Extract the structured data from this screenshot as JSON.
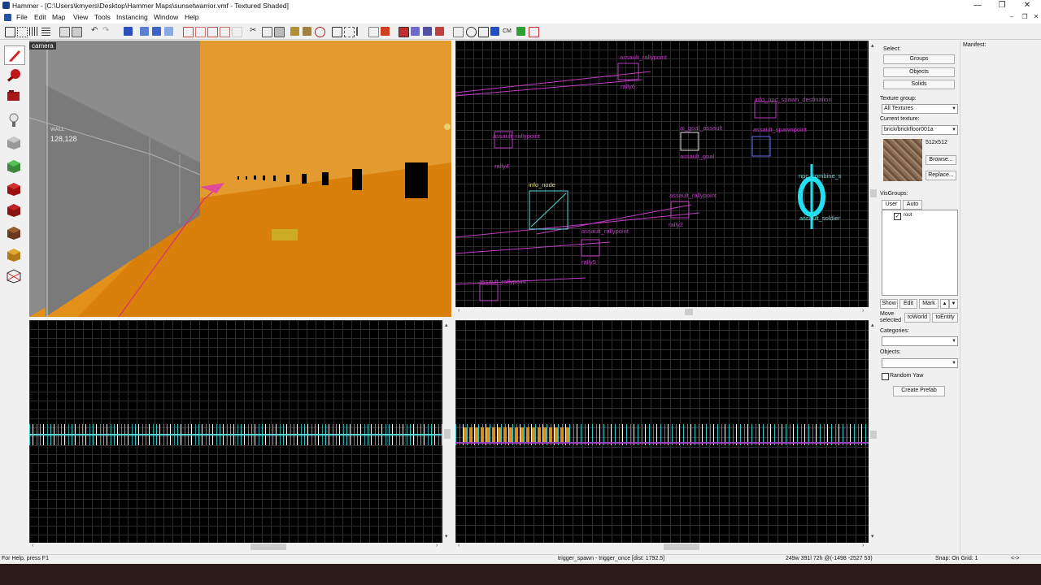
{
  "window": {
    "title": "Hammer - [C:\\Users\\kmyers\\Desktop\\Hammer Maps\\sunsetwarrior.vmf - Textured Shaded]",
    "controls": [
      "—",
      "❐",
      "✕"
    ],
    "doc_controls": [
      "–",
      "❐",
      "✕"
    ]
  },
  "menu": [
    "File",
    "Edit",
    "Map",
    "View",
    "Tools",
    "Instancing",
    "Window",
    "Help"
  ],
  "toolbar": {
    "cm_label": "CM"
  },
  "viewports": {
    "camera": {
      "label": "camera",
      "wall_label": "WALL",
      "wall_coord": "128,128"
    },
    "top": {
      "entities": {
        "assault_rallypoint_1": "assault_rallypoint",
        "rally6": "rally6",
        "info_npc_spawn_destination": "info_npc_spawn_destination",
        "ai_goal_assault": "ai_goal_assault",
        "assault_spawnpoint": "assault_spawnpoint",
        "assault_rallypoint_2": "assault_rallypoint",
        "rally4": "rally4",
        "assault_goal": "assault_goal",
        "npc_combine_s": "npc_combine_s",
        "info_node": "info_node",
        "assault_rallypoint_3": "assault_rallypoint",
        "rally2": "rally2",
        "assault_soldier": "assault_soldier",
        "assault_rallypoint_4": "assault_rallypoint",
        "rally5": "rally5",
        "assault_rallypoint_5": "assault_rallypoint"
      }
    }
  },
  "panel": {
    "select_label": "Select:",
    "groups": "Groups",
    "objects": "Objects",
    "solids": "Solids",
    "texture_group_label": "Texture group:",
    "texture_group_value": "All Textures",
    "current_texture_label": "Current texture:",
    "current_texture_value": "brick/brickfloor001a",
    "texture_size": "512x512",
    "browse": "Browse...",
    "replace": "Replace...",
    "visgroups_label": "VisGroups:",
    "tab_user": "User",
    "tab_auto": "Auto",
    "root_item": "root",
    "show": "Show",
    "edit": "Edit",
    "mark": "Mark",
    "move_selected": "Move selected",
    "to_world": "toWorld",
    "to_entity": "toEntity",
    "categories_label": "Categories:",
    "objects_label": "Objects:",
    "random_yaw": "Random Yaw",
    "create_prefab": "Create Prefab",
    "manifest_label": "Manifest:"
  },
  "status": {
    "help": "For Help, press F1",
    "selection": "trigger_spawn - trigger_once  [dist: 1792.5]",
    "coords": "249w 391l 72h @(-1498 -2527 53)",
    "snap": "Snap: On Grid: 1",
    "extra": "<->"
  },
  "colors": {
    "floor_orange": "#e08a12",
    "wall_gray": "#8c8c8c",
    "entity_magenta": "#c23cc6",
    "selected_cyan": "#22e0f0",
    "desktop": "#2b1b18"
  }
}
